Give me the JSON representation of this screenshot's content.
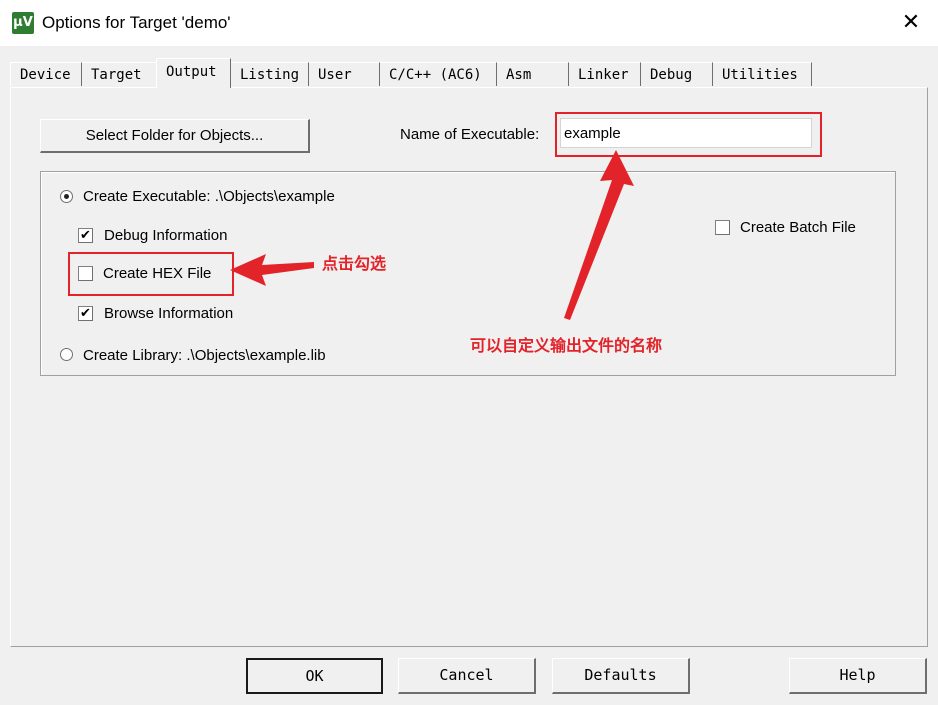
{
  "window": {
    "title": "Options for Target 'demo'",
    "icon": "uvision-icon",
    "close_glyph": "✕",
    "app_icon_text": "µV"
  },
  "tabs": [
    {
      "label": "Device"
    },
    {
      "label": "Target"
    },
    {
      "label": "Output"
    },
    {
      "label": "Listing"
    },
    {
      "label": "User"
    },
    {
      "label": "C/C++ (AC6)"
    },
    {
      "label": "Asm"
    },
    {
      "label": "Linker"
    },
    {
      "label": "Debug"
    },
    {
      "label": "Utilities"
    }
  ],
  "active_tab": "Output",
  "output": {
    "select_folder_label": "Select Folder for Objects...",
    "exe_name_label": "Name of Executable:",
    "exe_name_value": "example",
    "create_executable_label": "Create Executable:  .\\Objects\\example",
    "create_executable_selected": true,
    "debug_info_label": "Debug Information",
    "debug_info_checked": true,
    "create_hex_label": "Create HEX File",
    "create_hex_checked": false,
    "browse_info_label": "Browse Information",
    "browse_info_checked": true,
    "create_library_label": "Create Library:  .\\Objects\\example.lib",
    "create_library_selected": false,
    "create_batch_label": "Create Batch File",
    "create_batch_checked": false,
    "check_glyph": "✔"
  },
  "annotations": {
    "hex_note": "点击勾选",
    "exe_note": "可以自定义输出文件的名称",
    "color": "#e2232a"
  },
  "buttons": {
    "ok": "OK",
    "cancel": "Cancel",
    "defaults": "Defaults",
    "help": "Help"
  }
}
